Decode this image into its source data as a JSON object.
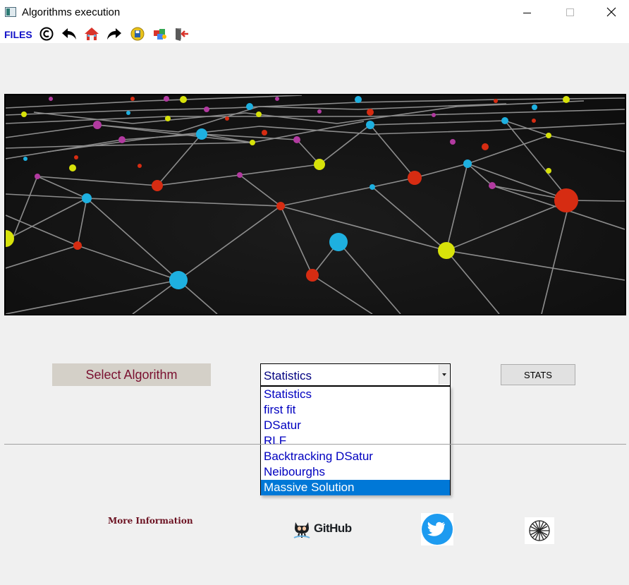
{
  "window": {
    "title": "Algorithms execution",
    "icons": {
      "app": "window-app-icon",
      "minimize": "minimize-icon",
      "maximize": "maximize-icon",
      "close": "close-icon"
    }
  },
  "toolbar": {
    "files_label": "FILES",
    "icons": [
      "copyright-icon",
      "undo-icon",
      "home-icon",
      "redo-icon",
      "save-icon",
      "puzzle-icon",
      "exit-icon"
    ]
  },
  "banner": {
    "icon": "network-graph-image"
  },
  "algorithm": {
    "label": "Select Algorithm",
    "selected": "Statistics",
    "options": [
      "Statistics",
      "first fit",
      "DSatur",
      "RLF",
      "Backtracking DSatur",
      "Neibourghs",
      "Massive Solution"
    ],
    "highlighted": "Massive Solution"
  },
  "stats_button": {
    "label": "STATS"
  },
  "footer": {
    "more_info": "More Information",
    "github_label": "GitHub",
    "icons": [
      "github-octocat-icon",
      "twitter-icon",
      "globe-icon"
    ]
  },
  "colors": {
    "accent": "#0078d7",
    "files_menu": "#1010c8",
    "list_text": "#0000c0",
    "label_text": "#7a1030",
    "twitter_blue": "#1d9bf0"
  }
}
